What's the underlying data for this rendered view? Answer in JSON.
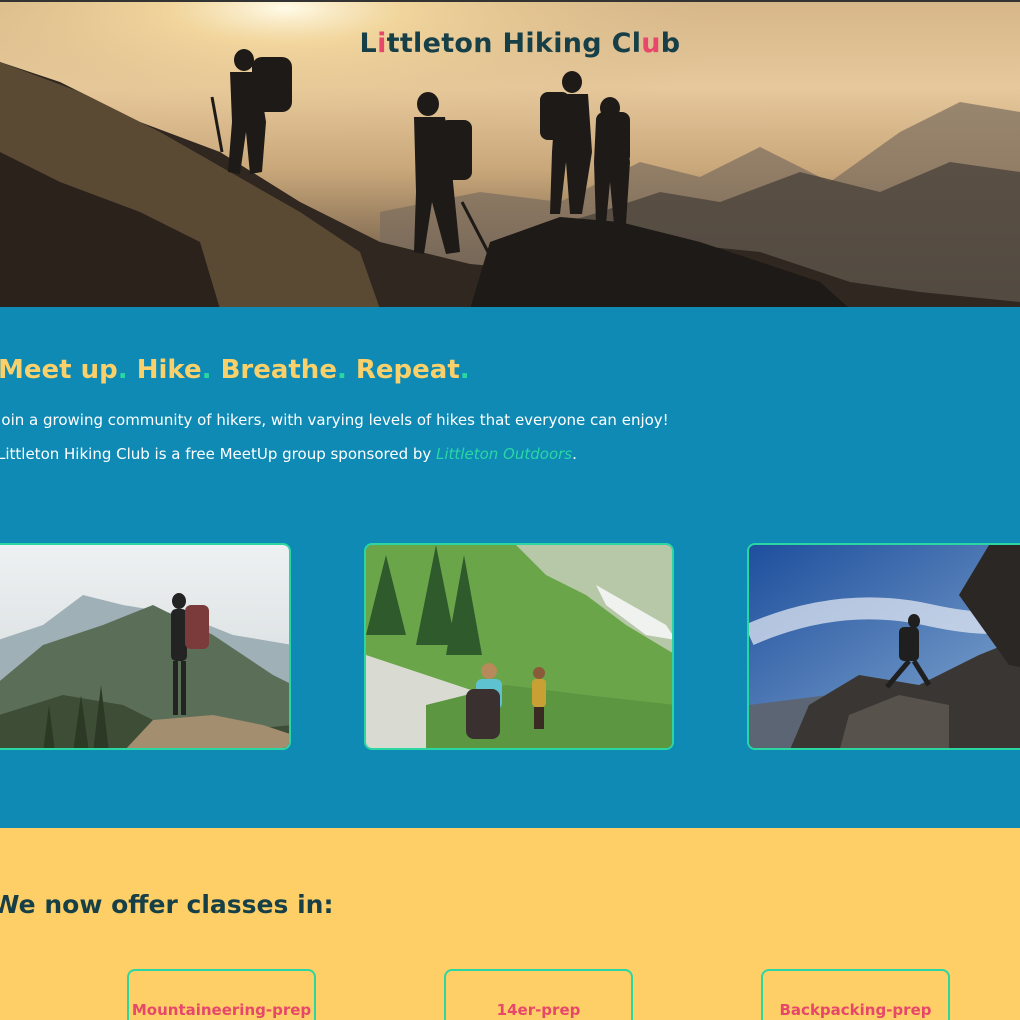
{
  "hero": {
    "title_parts": [
      "L",
      "i",
      "ttleton Hiking Cl",
      "u",
      "b"
    ],
    "image_icon": "hikers-silhouette-sunset-icon"
  },
  "intro": {
    "tagline_words": [
      "Meet up",
      "Hike",
      "Breathe",
      "Repeat"
    ],
    "tagline_dot": ".",
    "line1": "Join a growing community of hikers, with varying levels of hikes that everyone can enjoy!",
    "line2_before": "Littleton Hiking Club is a free MeetUp group sponsored by ",
    "sponsor_link": "Littleton Outdoors",
    "line2_after": "."
  },
  "photos": [
    {
      "icon": "hiker-mountain-view-photo"
    },
    {
      "icon": "hikers-alpine-meadow-photo"
    },
    {
      "icon": "hiker-climbing-rocks-photo"
    }
  ],
  "classes": {
    "title": "We now offer classes in:",
    "items": [
      "Mountaineering-prep",
      "14er-prep",
      "Backpacking-prep"
    ]
  },
  "colors": {
    "accent_pink": "#e7476a",
    "accent_green": "#2ad7a3",
    "tagline_yellow": "#f9d06a",
    "intro_blue": "#0e8ab5",
    "classes_yellow": "#fecf66",
    "dark_teal": "#163f47"
  }
}
